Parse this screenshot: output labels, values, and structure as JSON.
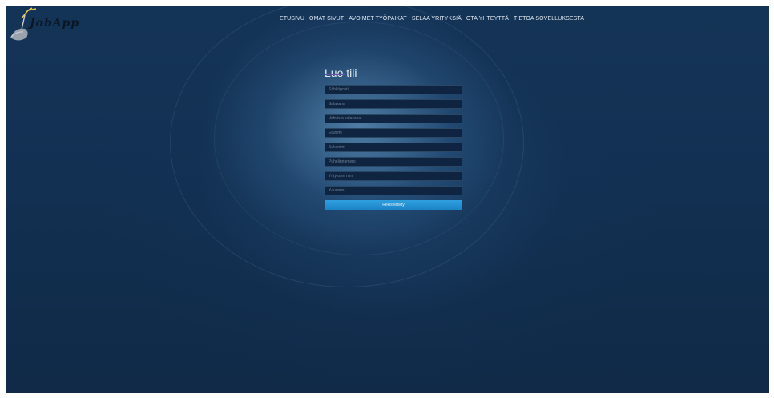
{
  "app": {
    "name": "JobApp"
  },
  "nav": {
    "items": [
      {
        "label": "ETUSIVU"
      },
      {
        "label": "OMAT SIVUT"
      },
      {
        "label": "AVOIMET TYÖPAIKAT"
      },
      {
        "label": "SELAA YRITYKSIÄ"
      },
      {
        "label": "OTA YHTEYTTÄ"
      },
      {
        "label": "TIETOA SOVELLUKSESTA"
      }
    ]
  },
  "form": {
    "title": "Luo tili",
    "fields": [
      {
        "placeholder": "Sähköposti"
      },
      {
        "placeholder": "Salasana"
      },
      {
        "placeholder": "Vahvista salasana"
      },
      {
        "placeholder": "Etunimi"
      },
      {
        "placeholder": "Sukunimi"
      },
      {
        "placeholder": "Puhelinnumero"
      },
      {
        "placeholder": "Yrityksen nimi"
      },
      {
        "placeholder": "Y-tunnus"
      }
    ],
    "submit_label": "Rekisteröidy"
  },
  "colors": {
    "accent": "#2a97da",
    "background": "#133456"
  },
  "icons": {
    "logo": "shovel-logo-icon"
  }
}
